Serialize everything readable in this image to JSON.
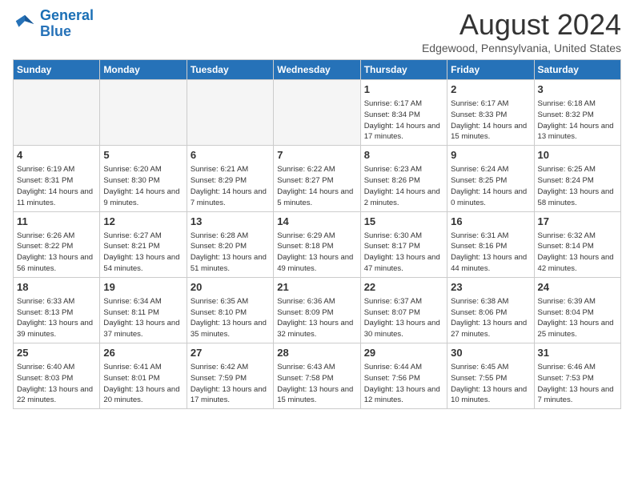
{
  "logo": {
    "line1": "General",
    "line2": "Blue"
  },
  "header": {
    "month": "August 2024",
    "location": "Edgewood, Pennsylvania, United States"
  },
  "days_of_week": [
    "Sunday",
    "Monday",
    "Tuesday",
    "Wednesday",
    "Thursday",
    "Friday",
    "Saturday"
  ],
  "weeks": [
    [
      {
        "day": "",
        "info": ""
      },
      {
        "day": "",
        "info": ""
      },
      {
        "day": "",
        "info": ""
      },
      {
        "day": "",
        "info": ""
      },
      {
        "day": "1",
        "info": "Sunrise: 6:17 AM\nSunset: 8:34 PM\nDaylight: 14 hours and 17 minutes."
      },
      {
        "day": "2",
        "info": "Sunrise: 6:17 AM\nSunset: 8:33 PM\nDaylight: 14 hours and 15 minutes."
      },
      {
        "day": "3",
        "info": "Sunrise: 6:18 AM\nSunset: 8:32 PM\nDaylight: 14 hours and 13 minutes."
      }
    ],
    [
      {
        "day": "4",
        "info": "Sunrise: 6:19 AM\nSunset: 8:31 PM\nDaylight: 14 hours and 11 minutes."
      },
      {
        "day": "5",
        "info": "Sunrise: 6:20 AM\nSunset: 8:30 PM\nDaylight: 14 hours and 9 minutes."
      },
      {
        "day": "6",
        "info": "Sunrise: 6:21 AM\nSunset: 8:29 PM\nDaylight: 14 hours and 7 minutes."
      },
      {
        "day": "7",
        "info": "Sunrise: 6:22 AM\nSunset: 8:27 PM\nDaylight: 14 hours and 5 minutes."
      },
      {
        "day": "8",
        "info": "Sunrise: 6:23 AM\nSunset: 8:26 PM\nDaylight: 14 hours and 2 minutes."
      },
      {
        "day": "9",
        "info": "Sunrise: 6:24 AM\nSunset: 8:25 PM\nDaylight: 14 hours and 0 minutes."
      },
      {
        "day": "10",
        "info": "Sunrise: 6:25 AM\nSunset: 8:24 PM\nDaylight: 13 hours and 58 minutes."
      }
    ],
    [
      {
        "day": "11",
        "info": "Sunrise: 6:26 AM\nSunset: 8:22 PM\nDaylight: 13 hours and 56 minutes."
      },
      {
        "day": "12",
        "info": "Sunrise: 6:27 AM\nSunset: 8:21 PM\nDaylight: 13 hours and 54 minutes."
      },
      {
        "day": "13",
        "info": "Sunrise: 6:28 AM\nSunset: 8:20 PM\nDaylight: 13 hours and 51 minutes."
      },
      {
        "day": "14",
        "info": "Sunrise: 6:29 AM\nSunset: 8:18 PM\nDaylight: 13 hours and 49 minutes."
      },
      {
        "day": "15",
        "info": "Sunrise: 6:30 AM\nSunset: 8:17 PM\nDaylight: 13 hours and 47 minutes."
      },
      {
        "day": "16",
        "info": "Sunrise: 6:31 AM\nSunset: 8:16 PM\nDaylight: 13 hours and 44 minutes."
      },
      {
        "day": "17",
        "info": "Sunrise: 6:32 AM\nSunset: 8:14 PM\nDaylight: 13 hours and 42 minutes."
      }
    ],
    [
      {
        "day": "18",
        "info": "Sunrise: 6:33 AM\nSunset: 8:13 PM\nDaylight: 13 hours and 39 minutes."
      },
      {
        "day": "19",
        "info": "Sunrise: 6:34 AM\nSunset: 8:11 PM\nDaylight: 13 hours and 37 minutes."
      },
      {
        "day": "20",
        "info": "Sunrise: 6:35 AM\nSunset: 8:10 PM\nDaylight: 13 hours and 35 minutes."
      },
      {
        "day": "21",
        "info": "Sunrise: 6:36 AM\nSunset: 8:09 PM\nDaylight: 13 hours and 32 minutes."
      },
      {
        "day": "22",
        "info": "Sunrise: 6:37 AM\nSunset: 8:07 PM\nDaylight: 13 hours and 30 minutes."
      },
      {
        "day": "23",
        "info": "Sunrise: 6:38 AM\nSunset: 8:06 PM\nDaylight: 13 hours and 27 minutes."
      },
      {
        "day": "24",
        "info": "Sunrise: 6:39 AM\nSunset: 8:04 PM\nDaylight: 13 hours and 25 minutes."
      }
    ],
    [
      {
        "day": "25",
        "info": "Sunrise: 6:40 AM\nSunset: 8:03 PM\nDaylight: 13 hours and 22 minutes."
      },
      {
        "day": "26",
        "info": "Sunrise: 6:41 AM\nSunset: 8:01 PM\nDaylight: 13 hours and 20 minutes."
      },
      {
        "day": "27",
        "info": "Sunrise: 6:42 AM\nSunset: 7:59 PM\nDaylight: 13 hours and 17 minutes."
      },
      {
        "day": "28",
        "info": "Sunrise: 6:43 AM\nSunset: 7:58 PM\nDaylight: 13 hours and 15 minutes."
      },
      {
        "day": "29",
        "info": "Sunrise: 6:44 AM\nSunset: 7:56 PM\nDaylight: 13 hours and 12 minutes."
      },
      {
        "day": "30",
        "info": "Sunrise: 6:45 AM\nSunset: 7:55 PM\nDaylight: 13 hours and 10 minutes."
      },
      {
        "day": "31",
        "info": "Sunrise: 6:46 AM\nSunset: 7:53 PM\nDaylight: 13 hours and 7 minutes."
      }
    ]
  ]
}
